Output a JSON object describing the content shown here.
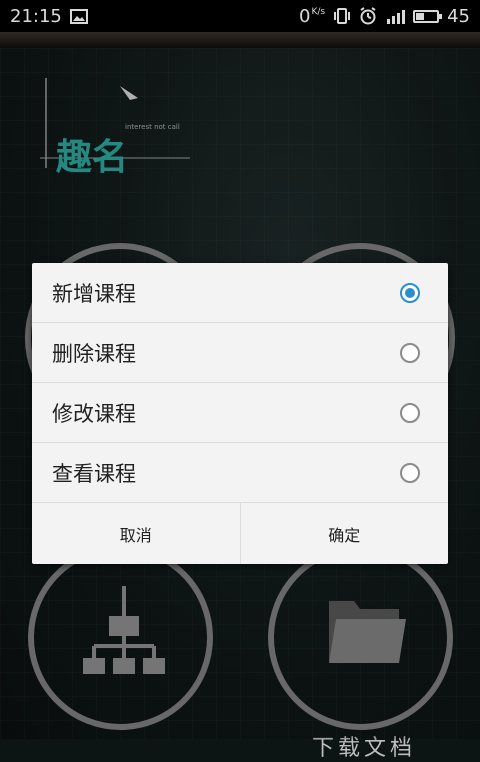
{
  "status_bar": {
    "time": "21:15",
    "net_speed_value": "0",
    "net_speed_unit": "K/s",
    "battery_level": "45",
    "icons": [
      "image-icon",
      "vibrate-icon",
      "alarm-icon",
      "signal-icon",
      "battery-icon"
    ]
  },
  "app": {
    "logo_text": "趣名",
    "logo_tagline": "interest not call",
    "bottom_label": "下载文档"
  },
  "dialog": {
    "options": [
      {
        "label": "新增课程",
        "selected": true
      },
      {
        "label": "删除课程",
        "selected": false
      },
      {
        "label": "修改课程",
        "selected": false
      },
      {
        "label": "查看课程",
        "selected": false
      }
    ],
    "cancel_label": "取消",
    "confirm_label": "确定"
  },
  "colors": {
    "accent": "#2a8fd0",
    "dialog_bg": "#f3f3f3",
    "logo_teal": "#2aa198",
    "logo_orange": "#e08a1e"
  }
}
